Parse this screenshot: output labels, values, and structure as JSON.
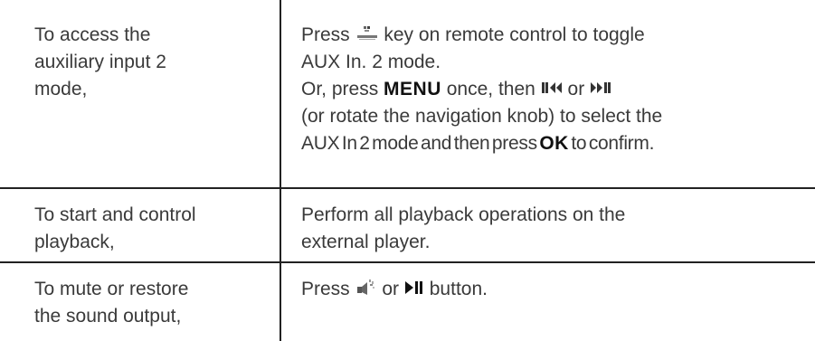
{
  "rows": [
    {
      "left_lines": [
        "To access the",
        "auxiliary input 2",
        "mode,"
      ],
      "right": {
        "line1_pre": "Press",
        "line1_icon": "aux-in-2-remote-key-icon",
        "line1_post": "key on remote control to toggle",
        "line2": "AUX In. 2 mode.",
        "line3_pre": "Or, press",
        "line3_key": "MENU",
        "line3_mid": "once, then",
        "line3_icon1": "previous-track-icon",
        "line3_or": "or",
        "line3_icon2": "next-track-icon",
        "line4": "(or rotate the navigation knob) to select the",
        "line5_pre": "AUX In 2 mode and then press",
        "line5_key": "OK",
        "line5_post": "to confirm."
      }
    },
    {
      "left_lines": [
        "To start and control",
        "playback,"
      ],
      "right_lines": [
        "Perform all playback operations on the",
        "external player."
      ]
    },
    {
      "left_lines": [
        "To mute or restore",
        "the sound output,"
      ],
      "right": {
        "pre": "Press",
        "icon1": "mute-key-icon",
        "or": "or",
        "icon2": "play-pause-icon",
        "post": "button."
      }
    }
  ],
  "colors": {
    "text": "#3a3a3a",
    "rule": "#222222",
    "emphasis": "#111111"
  }
}
